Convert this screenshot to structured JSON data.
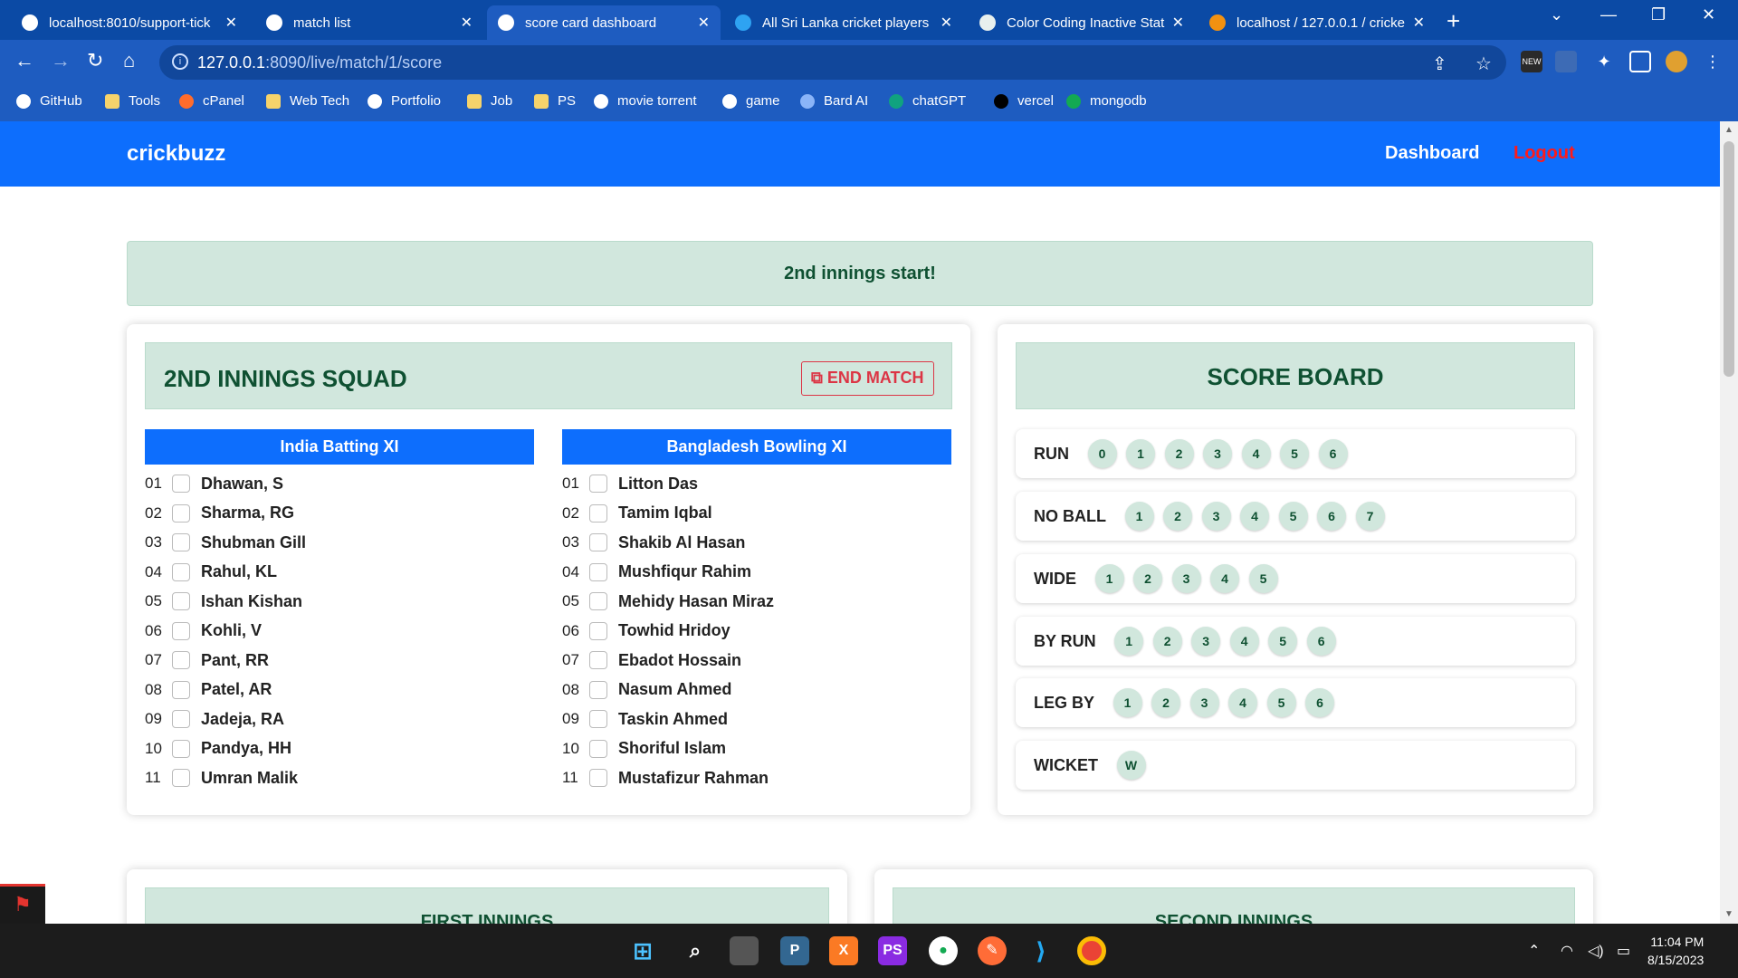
{
  "browser": {
    "tabs": [
      {
        "title": "localhost:8010/support-tick",
        "favicon_color": "#ffffff"
      },
      {
        "title": "match list",
        "favicon_color": "#ffffff"
      },
      {
        "title": "score card dashboard",
        "favicon_color": "#ffffff"
      },
      {
        "title": "All Sri Lanka cricket players",
        "favicon_color": "#2ea3f2"
      },
      {
        "title": "Color Coding Inactive Statu",
        "favicon_color": "#e8f0ee"
      },
      {
        "title": "localhost / 127.0.0.1 / cricke",
        "favicon_color": "#f29111"
      }
    ],
    "url_host": "127.0.0.1",
    "url_rest": ":8090/live/match/1/score",
    "extension_badge": "NEW",
    "bookmarks": [
      {
        "label": "GitHub",
        "icon": "github-icon"
      },
      {
        "label": "Tools",
        "icon": "folder-icon"
      },
      {
        "label": "cPanel",
        "icon": "cpanel-icon"
      },
      {
        "label": "Web Tech",
        "icon": "folder-icon"
      },
      {
        "label": "Portfolio",
        "icon": "portfolio-icon"
      },
      {
        "label": "Job",
        "icon": "folder-icon"
      },
      {
        "label": "PS",
        "icon": "folder-icon"
      },
      {
        "label": "movie torrent",
        "icon": "bank-icon"
      },
      {
        "label": "game",
        "icon": "game-icon"
      },
      {
        "label": "Bard AI",
        "icon": "bard-icon"
      },
      {
        "label": "chatGPT",
        "icon": "chatgpt-icon"
      },
      {
        "label": "vercel",
        "icon": "vercel-icon"
      },
      {
        "label": "mongodb",
        "icon": "mongodb-icon"
      }
    ]
  },
  "navbar": {
    "brand": "crickbuzz",
    "dashboard": "Dashboard",
    "logout": "Logout"
  },
  "alert": "2nd innings start!",
  "squad": {
    "title": "2ND INNINGS SQUAD",
    "end_match": "END MATCH",
    "batting_team": "India Batting XI",
    "bowling_team": "Bangladesh Bowling XI",
    "batting": [
      {
        "num": "01",
        "name": "Dhawan, S"
      },
      {
        "num": "02",
        "name": "Sharma, RG"
      },
      {
        "num": "03",
        "name": "Shubman Gill"
      },
      {
        "num": "04",
        "name": "Rahul, KL"
      },
      {
        "num": "05",
        "name": "Ishan Kishan"
      },
      {
        "num": "06",
        "name": "Kohli, V"
      },
      {
        "num": "07",
        "name": "Pant, RR"
      },
      {
        "num": "08",
        "name": "Patel, AR"
      },
      {
        "num": "09",
        "name": "Jadeja, RA"
      },
      {
        "num": "10",
        "name": "Pandya, HH"
      },
      {
        "num": "11",
        "name": "Umran Malik"
      }
    ],
    "bowling": [
      {
        "num": "01",
        "name": "Litton Das"
      },
      {
        "num": "02",
        "name": "Tamim Iqbal"
      },
      {
        "num": "03",
        "name": "Shakib Al Hasan"
      },
      {
        "num": "04",
        "name": "Mushfiqur Rahim"
      },
      {
        "num": "05",
        "name": "Mehidy Hasan Miraz"
      },
      {
        "num": "06",
        "name": "Towhid Hridoy"
      },
      {
        "num": "07",
        "name": "Ebadot Hossain"
      },
      {
        "num": "08",
        "name": "Nasum Ahmed"
      },
      {
        "num": "09",
        "name": "Taskin Ahmed"
      },
      {
        "num": "10",
        "name": "Shoriful Islam"
      },
      {
        "num": "11",
        "name": "Mustafizur Rahman"
      }
    ]
  },
  "scoreboard": {
    "title": "SCORE BOARD",
    "rows": [
      {
        "label": "RUN",
        "options": [
          "0",
          "1",
          "2",
          "3",
          "4",
          "5",
          "6"
        ]
      },
      {
        "label": "NO BALL",
        "options": [
          "1",
          "2",
          "3",
          "4",
          "5",
          "6",
          "7"
        ]
      },
      {
        "label": "WIDE",
        "options": [
          "1",
          "2",
          "3",
          "4",
          "5"
        ]
      },
      {
        "label": "BY RUN",
        "options": [
          "1",
          "2",
          "3",
          "4",
          "5",
          "6"
        ]
      },
      {
        "label": "LEG BY",
        "options": [
          "1",
          "2",
          "3",
          "4",
          "5",
          "6"
        ]
      },
      {
        "label": "WICKET",
        "options": [
          "W"
        ]
      }
    ]
  },
  "innings": {
    "first": "FIRST INNINGS",
    "second": "SECOND INNINGS"
  },
  "taskbar": {
    "time": "11:04 PM",
    "date": "8/15/2023"
  },
  "colors": {
    "primary": "#0d6efd",
    "success_bg": "#d1e7dd",
    "success_text": "#0f5132",
    "danger": "#dc3545",
    "logout": "#ff1a1a",
    "chrome": "#1e5cc0"
  }
}
